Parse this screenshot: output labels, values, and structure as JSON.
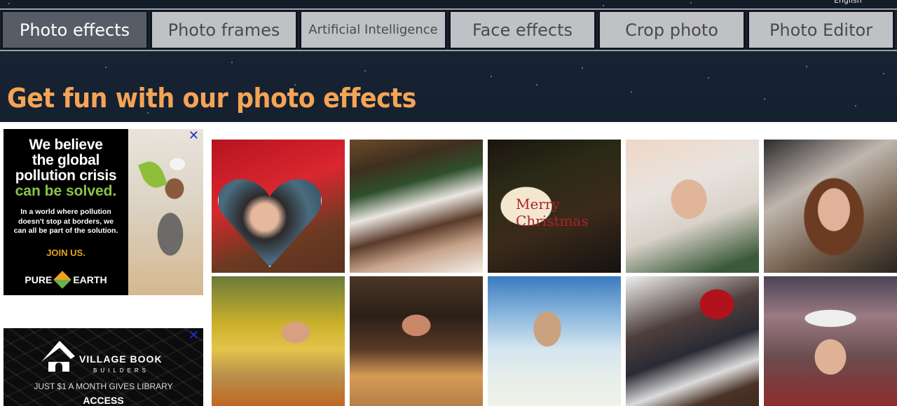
{
  "header": {
    "language_label": "English",
    "tabs": [
      {
        "label": "Photo effects",
        "active": true
      },
      {
        "label": "Photo frames",
        "active": false
      },
      {
        "label": "Artificial Intelligence",
        "active": false
      },
      {
        "label": "Face effects",
        "active": false
      },
      {
        "label": "Crop photo",
        "active": false
      },
      {
        "label": "Photo Editor",
        "active": false
      }
    ],
    "headline": "Get fun with our photo effects"
  },
  "ads": [
    {
      "headline_lines": [
        "We believe",
        "the global",
        "pollution crisis"
      ],
      "highlight": "can be solved.",
      "body_lines": [
        "In a world where pollution",
        "doesn't stop at borders, we",
        "can all be part of the solution."
      ],
      "cta": "JOIN US.",
      "brand_left": "PURE",
      "brand_right": "EARTH",
      "close_label": "✕"
    },
    {
      "brand": "VILLAGE BOOK",
      "brand_sub": "BUILDERS",
      "tagline": "JUST $1 A MONTH GIVES LIBRARY",
      "tagline_2": "ACCESS",
      "close_label": "✕"
    }
  ],
  "gallery": {
    "items": [
      {
        "name": "heart-locket-effect"
      },
      {
        "name": "christmas-frame-effect"
      },
      {
        "name": "merry-christmas-card-effect",
        "text": "Merry Christmas"
      },
      {
        "name": "winter-hat-effect"
      },
      {
        "name": "cloud-moon-effect"
      },
      {
        "name": "autumn-couple-effect"
      },
      {
        "name": "room-painting-effect"
      },
      {
        "name": "beach-sky-face-effect"
      },
      {
        "name": "rose-book-effect"
      },
      {
        "name": "santa-sparkle-effect"
      }
    ]
  },
  "colors": {
    "headline": "#f4a455",
    "active_tab": "#565d66",
    "inactive_tab": "#bfc1c4",
    "ad_highlight_green": "#8bc34a",
    "ad_cta_orange": "#e8a21b",
    "ad_close_blue": "#1d2ed6"
  }
}
